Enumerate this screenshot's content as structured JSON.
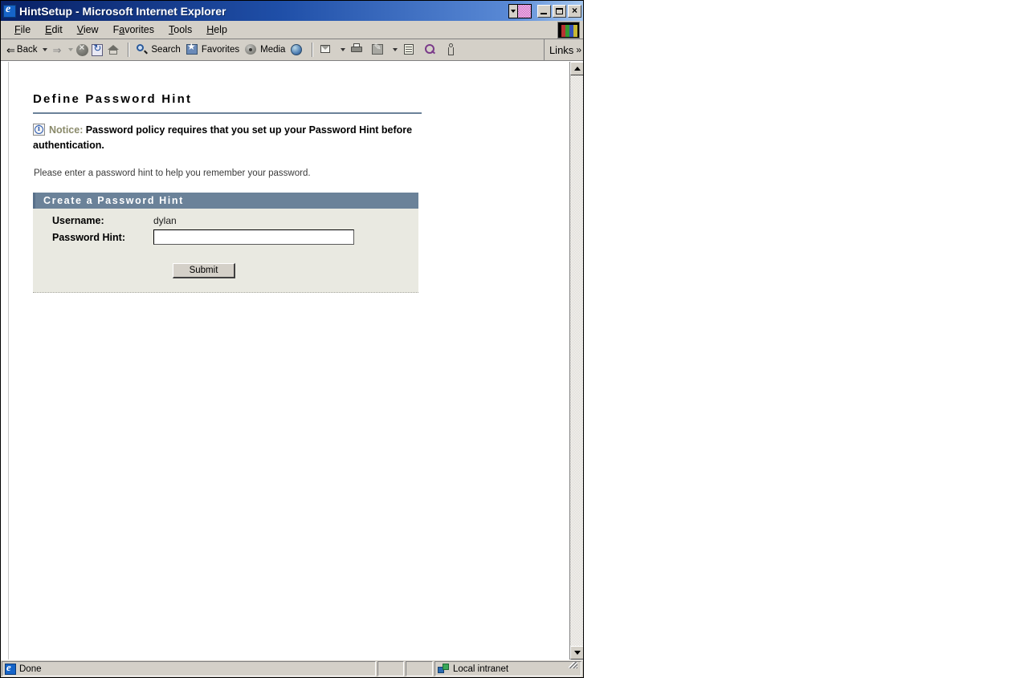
{
  "window": {
    "title": "HintSetup - Microsoft Internet Explorer",
    "app_icon": "ie-globe-icon",
    "buttons": {
      "restore_dropdown": "restore-dropdown-arrow",
      "minimize": "",
      "maximize": "",
      "close": "×"
    }
  },
  "menubar": {
    "items": [
      {
        "label": "File",
        "accel": "F",
        "rest": "ile"
      },
      {
        "label": "Edit",
        "accel": "E",
        "rest": "dit"
      },
      {
        "label": "View",
        "accel": "V",
        "rest": "iew"
      },
      {
        "label": "Favorites",
        "accel": "a",
        "pre": "F",
        "rest": "vorites"
      },
      {
        "label": "Tools",
        "accel": "T",
        "rest": "ools"
      },
      {
        "label": "Help",
        "accel": "H",
        "rest": "elp"
      }
    ]
  },
  "toolbar": {
    "back_label": "Back",
    "back_arrow": "⇐",
    "forward_arrow": "⇒",
    "search_label": "Search",
    "favorites_label": "Favorites",
    "media_label": "Media",
    "links_label": "Links",
    "links_chevron": "»"
  },
  "page": {
    "title": "Define Password Hint",
    "notice_label": "Notice:",
    "notice_text": "Password policy requires that you set up your Password Hint before authentication.",
    "helper_text": "Please enter a password hint to help you remember your password.",
    "panel": {
      "header": "Create a Password Hint",
      "username_label": "Username:",
      "username_value": "dylan",
      "hint_label": "Password Hint:",
      "hint_value": "",
      "hint_placeholder": "",
      "submit_label": "Submit"
    }
  },
  "statusbar": {
    "status_text": "Done",
    "zone_text": "Local intranet"
  },
  "colors": {
    "accent_steel": "#6b8299",
    "title_blue": "#0a246a",
    "panel_bg": "#e9e9e1",
    "chrome": "#d4d0c8",
    "notice_label": "#8a8a6a"
  }
}
